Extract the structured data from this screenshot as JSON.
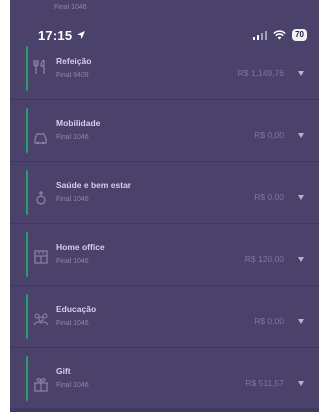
{
  "status_bar": {
    "time": "17:15",
    "battery": "70"
  },
  "peek_row": {
    "subtitle": "Final 1046"
  },
  "benefits": [
    {
      "title": "Refeição",
      "subtitle": "Final 9409",
      "amount": "R$ 1.149,76",
      "icon": "utensils-icon"
    },
    {
      "title": "Mobilidade",
      "subtitle": "Final 1046",
      "amount": "R$ 0,00",
      "icon": "car-icon"
    },
    {
      "title": "Saúde e bem estar",
      "subtitle": "Final 1046",
      "amount": "R$ 0,00",
      "icon": "health-icon"
    },
    {
      "title": "Home office",
      "subtitle": "Final 1046",
      "amount": "R$ 120,00",
      "icon": "building-icon"
    },
    {
      "title": "Educação",
      "subtitle": "Final 1046",
      "amount": "R$ 0,00",
      "icon": "graduation-icon"
    },
    {
      "title": "Gift",
      "subtitle": "Final 1046",
      "amount": "R$ 511,57",
      "icon": "gift-icon"
    }
  ],
  "colors": {
    "background": "#4b426b",
    "accent": "#1fa36a",
    "title": "#d6cfe9",
    "subtitle": "#8d85a9",
    "amount": "#7e769f"
  }
}
